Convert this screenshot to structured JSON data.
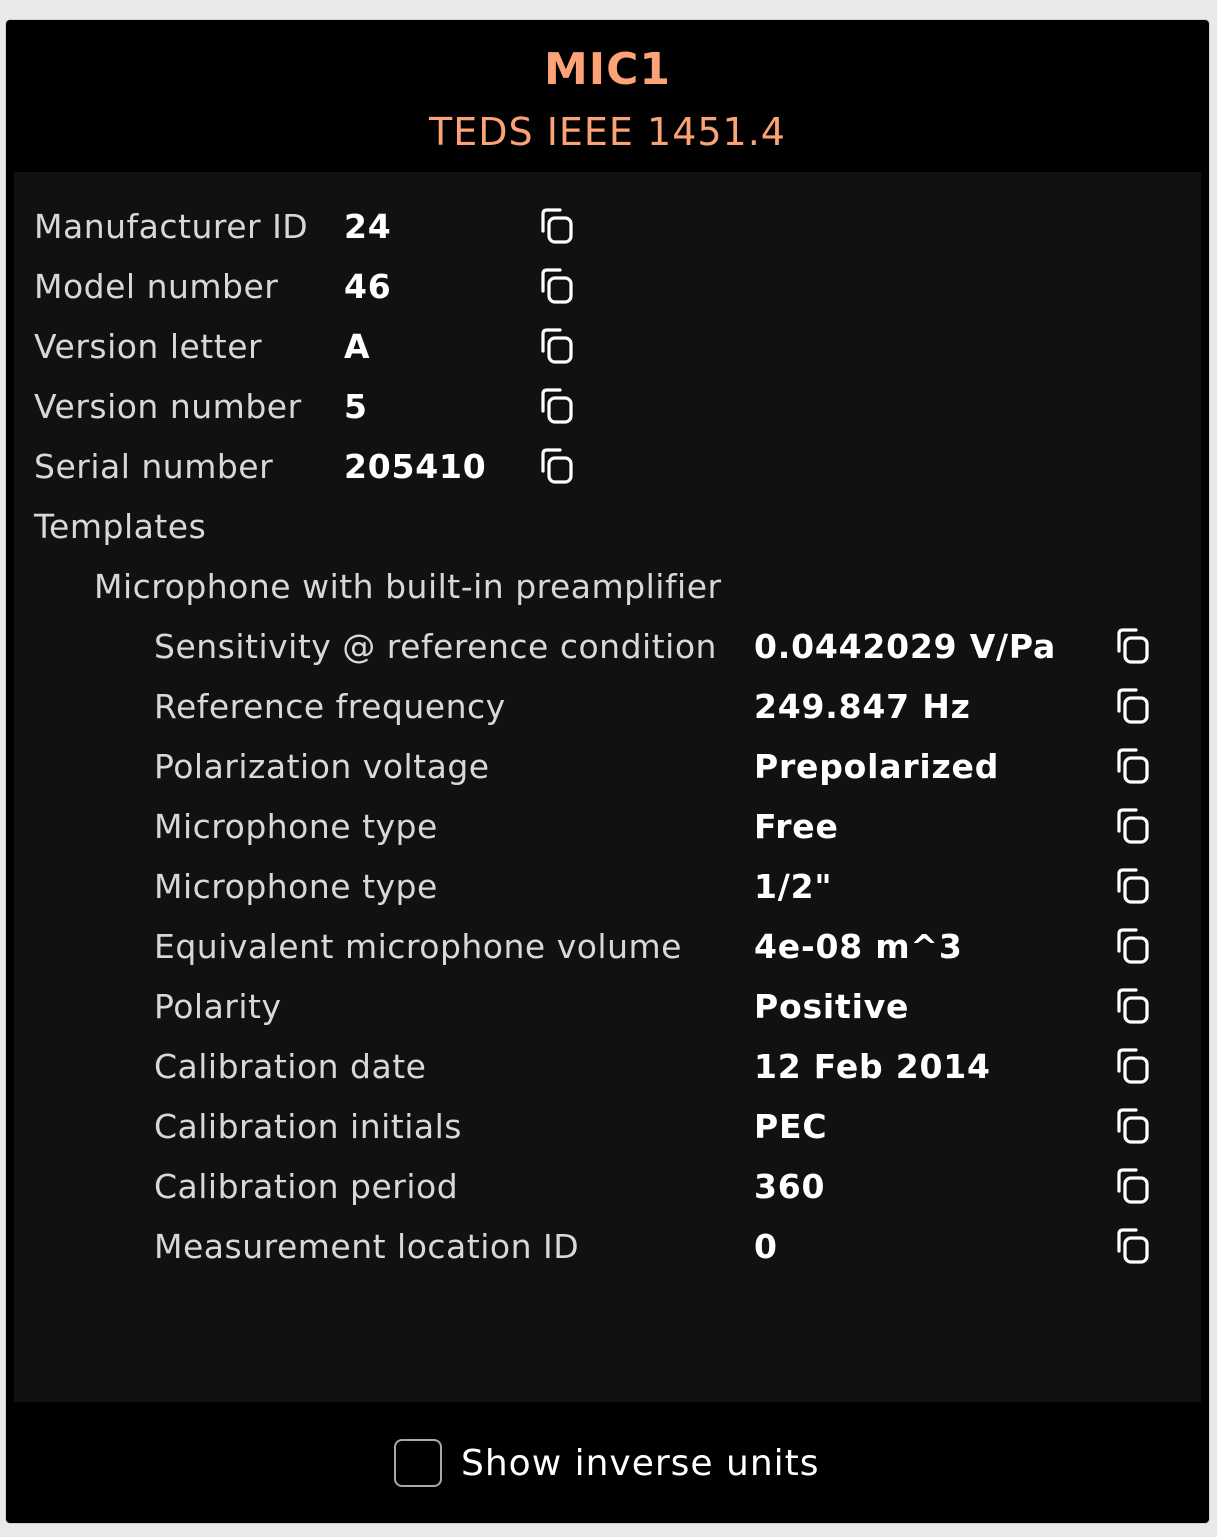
{
  "header": {
    "title": "MIC1",
    "subtitle": "TEDS IEEE 1451.4"
  },
  "basic": [
    {
      "label": "Manufacturer ID",
      "value": "24"
    },
    {
      "label": "Model number",
      "value": "46"
    },
    {
      "label": "Version letter",
      "value": "A"
    },
    {
      "label": "Version number",
      "value": "5"
    },
    {
      "label": "Serial number",
      "value": "205410"
    }
  ],
  "templates_label": "Templates",
  "template": {
    "name": "Microphone with built-in preamplifier",
    "fields": [
      {
        "label": "Sensitivity @ reference condition",
        "value": "0.0442029 V/Pa"
      },
      {
        "label": "Reference frequency",
        "value": "249.847 Hz"
      },
      {
        "label": "Polarization voltage",
        "value": "Prepolarized"
      },
      {
        "label": "Microphone type",
        "value": "Free"
      },
      {
        "label": "Microphone type",
        "value": "1/2\""
      },
      {
        "label": "Equivalent microphone volume",
        "value": "4e-08 m^3"
      },
      {
        "label": "Polarity",
        "value": "Positive"
      },
      {
        "label": "Calibration date",
        "value": "12 Feb 2014"
      },
      {
        "label": "Calibration initials",
        "value": "PEC"
      },
      {
        "label": "Calibration period",
        "value": "360"
      },
      {
        "label": "Measurement location ID",
        "value": "0"
      }
    ]
  },
  "footer": {
    "show_inverse_units_label": "Show inverse units",
    "show_inverse_units_checked": false
  },
  "colors": {
    "accent": "#fba277",
    "background": "#000000",
    "panel": "#111111",
    "label_text": "#d8d8d8",
    "value_text": "#ffffff"
  },
  "icons": {
    "copy": "copy-icon"
  }
}
